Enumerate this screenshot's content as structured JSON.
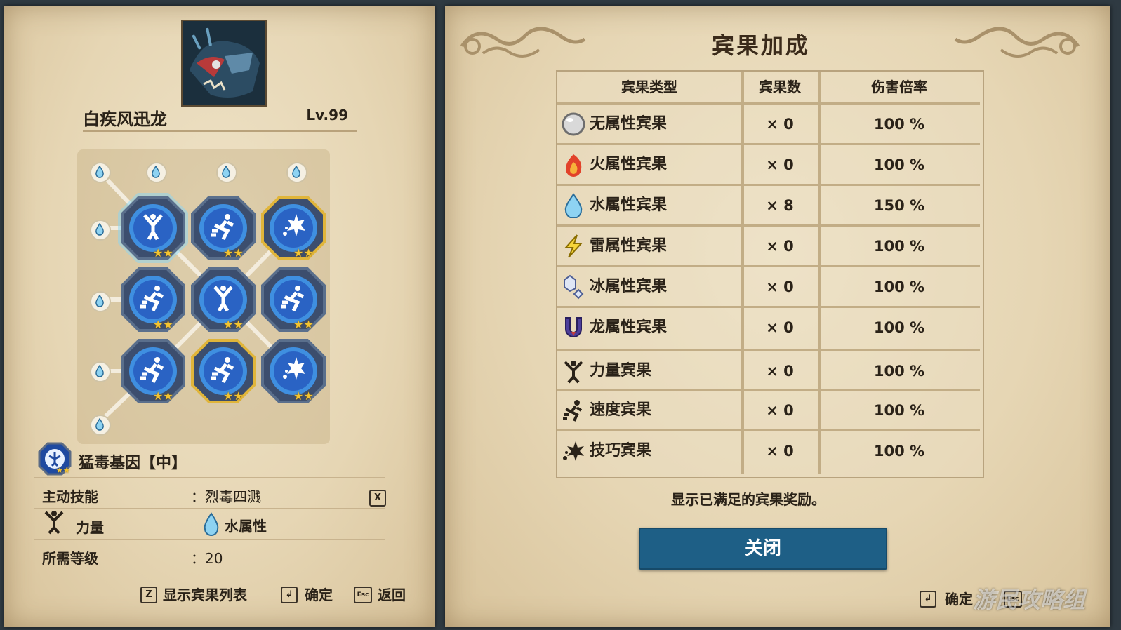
{
  "monster": {
    "name": "白疾风迅龙",
    "level": "Lv.99"
  },
  "gene": {
    "name": "猛毒基因【中】",
    "active_skill_label": "主动技能",
    "active_skill_value": "：烈毒四溅",
    "key_x": "X",
    "type_label": "力量",
    "element_label": "水属性",
    "req_level_label": "所需等级",
    "req_level_value": "：20"
  },
  "left_footer": {
    "z_key": "Z",
    "z_label": "显示宾果列表",
    "enter_label": "确定",
    "esc_key": "Esc",
    "esc_label": "返回"
  },
  "grid_genes": [
    {
      "icon": "power-icon",
      "border": "blue"
    },
    {
      "icon": "speed-icon",
      "border": "blue"
    },
    {
      "icon": "technique-icon",
      "border": "gold"
    },
    {
      "icon": "speed-icon",
      "border": "blue"
    },
    {
      "icon": "power-icon",
      "border": "blue"
    },
    {
      "icon": "speed-icon",
      "border": "blue"
    },
    {
      "icon": "speed-icon",
      "border": "blue"
    },
    {
      "icon": "speed-icon",
      "border": "gold"
    },
    {
      "icon": "technique-icon",
      "border": "blue"
    }
  ],
  "bonus": {
    "title": "宾果加成",
    "headers": [
      "宾果类型",
      "宾果数",
      "伤害倍率"
    ],
    "rows": [
      {
        "icon": "neutral-orb-icon",
        "name": "无属性宾果",
        "count": "× 0",
        "rate": "100 %"
      },
      {
        "icon": "fire-icon",
        "name": "火属性宾果",
        "count": "× 0",
        "rate": "100 %"
      },
      {
        "icon": "water-icon",
        "name": "水属性宾果",
        "count": "× 8",
        "rate": "150 %"
      },
      {
        "icon": "thunder-icon",
        "name": "雷属性宾果",
        "count": "× 0",
        "rate": "100 %"
      },
      {
        "icon": "ice-icon",
        "name": "冰属性宾果",
        "count": "× 0",
        "rate": "100 %"
      },
      {
        "icon": "dragon-icon",
        "name": "龙属性宾果",
        "count": "× 0",
        "rate": "100 %"
      },
      {
        "icon": "power-icon",
        "name": "力量宾果",
        "count": "× 0",
        "rate": "100 %"
      },
      {
        "icon": "speed-icon",
        "name": "速度宾果",
        "count": "× 0",
        "rate": "100 %"
      },
      {
        "icon": "technique-icon",
        "name": "技巧宾果",
        "count": "× 0",
        "rate": "100 %"
      }
    ],
    "note": "显示已满足的宾果奖励。",
    "close_label": "关闭"
  },
  "right_footer": {
    "enter_label": "确定",
    "esc_key": "Esc"
  },
  "watermark": "游民攻略组",
  "colors": {
    "accent_blue": "#1e5f86",
    "gold": "#f4c430",
    "parchment": "#e6d6b4"
  }
}
